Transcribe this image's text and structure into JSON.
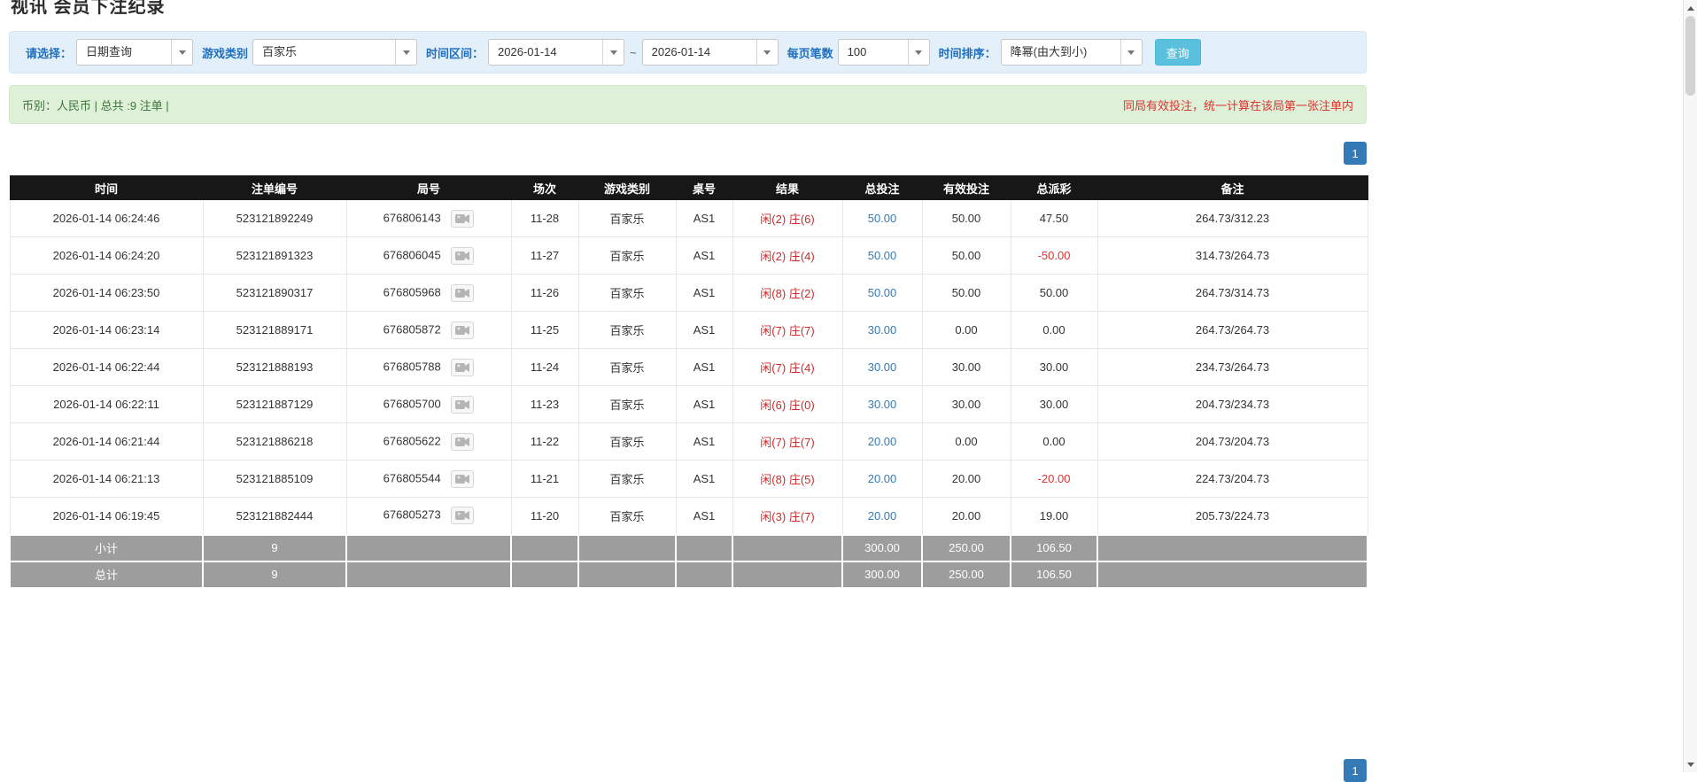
{
  "colors": {
    "accent_blue": "#337ab7",
    "search_button_blue": "#5bc0de",
    "filter_bar_bg": "#e3f0fa",
    "info_bar_bg": "#dff0d8",
    "info_text_green": "#3c763d",
    "warning_red": "#d9352f",
    "table_header_bg": "#171717",
    "table_footer_bg": "#9d9d9d",
    "negative_red": "#e03131",
    "result_red": "#cc2a2a"
  },
  "page": {
    "title": "视讯 会员下注纪录"
  },
  "filters": {
    "select_label": "请选择：",
    "select_value": "日期查询",
    "game_type_label": "游戏类别",
    "game_type_value": "百家乐",
    "time_range_label": "时间区间：",
    "date_from": "2026-01-14",
    "range_separator": "~",
    "date_to": "2026-01-14",
    "page_size_label": "每页笔数",
    "page_size_value": "100",
    "sort_label": "时间排序：",
    "sort_value": "降幂(由大到小)",
    "search_button_label": "查询"
  },
  "summary": {
    "left_text": "币别：人民币 | 总共 :9 注单 |",
    "right_text": "同局有效投注，统一计算在该局第一张注单内"
  },
  "pagination": {
    "current_page": "1"
  },
  "icons": {
    "round_video_icon": "video-camera",
    "dropdown_caret": "chevron-down",
    "scroll_up": "triangle-up",
    "scroll_down": "triangle-down"
  },
  "table": {
    "headers": [
      "时间",
      "注单编号",
      "局号",
      "场次",
      "游戏类别",
      "桌号",
      "结果",
      "总投注",
      "有效投注",
      "总派彩",
      "备注"
    ],
    "rows": [
      {
        "time": "2026-01-14 06:24:46",
        "bet_id": "523121892249",
        "round_id": "676806143",
        "session": "11-28",
        "game": "百家乐",
        "table": "AS1",
        "result_player": "闲(2)",
        "result_banker": "庄(6)",
        "total_bet": "50.00",
        "valid_bet": "50.00",
        "payout": "47.50",
        "remark": "264.73/312.23"
      },
      {
        "time": "2026-01-14 06:24:20",
        "bet_id": "523121891323",
        "round_id": "676806045",
        "session": "11-27",
        "game": "百家乐",
        "table": "AS1",
        "result_player": "闲(2)",
        "result_banker": "庄(4)",
        "total_bet": "50.00",
        "valid_bet": "50.00",
        "payout": "-50.00",
        "remark": "314.73/264.73"
      },
      {
        "time": "2026-01-14 06:23:50",
        "bet_id": "523121890317",
        "round_id": "676805968",
        "session": "11-26",
        "game": "百家乐",
        "table": "AS1",
        "result_player": "闲(8)",
        "result_banker": "庄(2)",
        "total_bet": "50.00",
        "valid_bet": "50.00",
        "payout": "50.00",
        "remark": "264.73/314.73"
      },
      {
        "time": "2026-01-14 06:23:14",
        "bet_id": "523121889171",
        "round_id": "676805872",
        "session": "11-25",
        "game": "百家乐",
        "table": "AS1",
        "result_player": "闲(7)",
        "result_banker": "庄(7)",
        "total_bet": "30.00",
        "valid_bet": "0.00",
        "payout": "0.00",
        "remark": "264.73/264.73"
      },
      {
        "time": "2026-01-14 06:22:44",
        "bet_id": "523121888193",
        "round_id": "676805788",
        "session": "11-24",
        "game": "百家乐",
        "table": "AS1",
        "result_player": "闲(7)",
        "result_banker": "庄(4)",
        "total_bet": "30.00",
        "valid_bet": "30.00",
        "payout": "30.00",
        "remark": "234.73/264.73"
      },
      {
        "time": "2026-01-14 06:22:11",
        "bet_id": "523121887129",
        "round_id": "676805700",
        "session": "11-23",
        "game": "百家乐",
        "table": "AS1",
        "result_player": "闲(6)",
        "result_banker": "庄(0)",
        "total_bet": "30.00",
        "valid_bet": "30.00",
        "payout": "30.00",
        "remark": "204.73/234.73"
      },
      {
        "time": "2026-01-14 06:21:44",
        "bet_id": "523121886218",
        "round_id": "676805622",
        "session": "11-22",
        "game": "百家乐",
        "table": "AS1",
        "result_player": "闲(7)",
        "result_banker": "庄(7)",
        "total_bet": "20.00",
        "valid_bet": "0.00",
        "payout": "0.00",
        "remark": "204.73/204.73"
      },
      {
        "time": "2026-01-14 06:21:13",
        "bet_id": "523121885109",
        "round_id": "676805544",
        "session": "11-21",
        "game": "百家乐",
        "table": "AS1",
        "result_player": "闲(8)",
        "result_banker": "庄(5)",
        "total_bet": "20.00",
        "valid_bet": "20.00",
        "payout": "-20.00",
        "remark": "224.73/204.73"
      },
      {
        "time": "2026-01-14 06:19:45",
        "bet_id": "523121882444",
        "round_id": "676805273",
        "session": "11-20",
        "game": "百家乐",
        "table": "AS1",
        "result_player": "闲(3)",
        "result_banker": "庄(7)",
        "total_bet": "20.00",
        "valid_bet": "20.00",
        "payout": "19.00",
        "remark": "205.73/224.73"
      }
    ],
    "subtotal": {
      "label": "小计",
      "count": "9",
      "total_bet": "300.00",
      "valid_bet": "250.00",
      "payout": "106.50"
    },
    "total": {
      "label": "总计",
      "count": "9",
      "total_bet": "300.00",
      "valid_bet": "250.00",
      "payout": "106.50"
    }
  }
}
